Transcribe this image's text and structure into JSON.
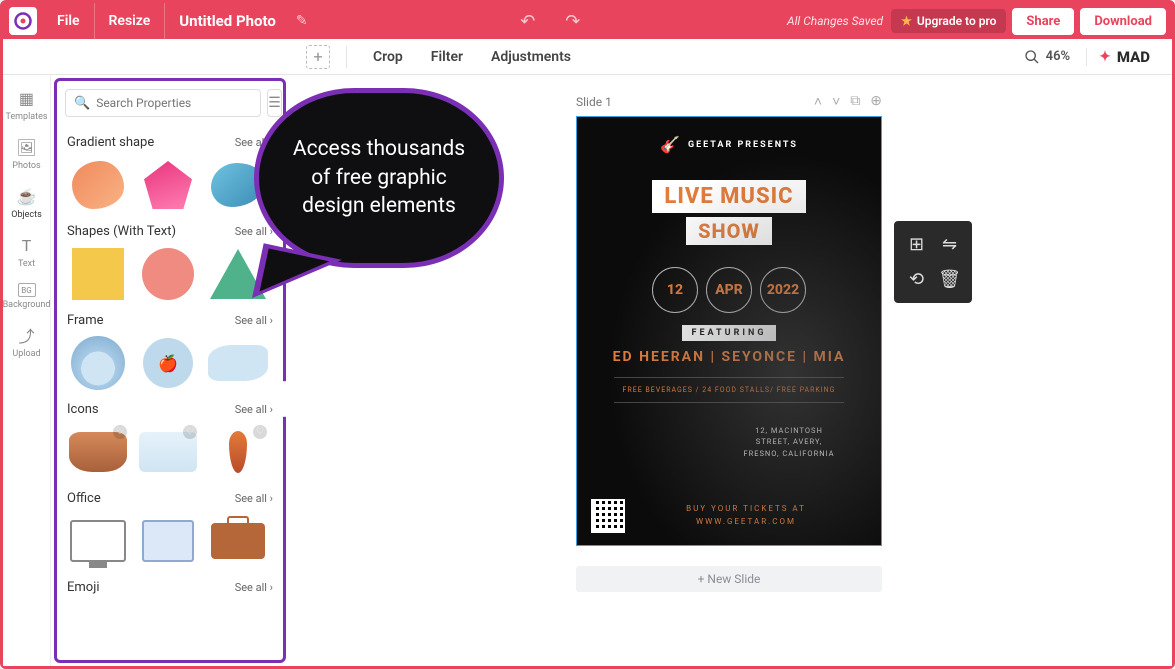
{
  "topbar": {
    "file": "File",
    "resize": "Resize",
    "title": "Untitled Photo",
    "saved": "All Changes Saved",
    "upgrade": "Upgrade to pro",
    "share": "Share",
    "download": "Download"
  },
  "toolbar": {
    "crop": "Crop",
    "filter": "Filter",
    "adjustments": "Adjustments",
    "zoom": "46%",
    "brand": "MAD"
  },
  "rail": {
    "templates": "Templates",
    "photos": "Photos",
    "objects": "Objects",
    "text": "Text",
    "background": "Background",
    "upload": "Upload"
  },
  "panel": {
    "search_placeholder": "Search Properties",
    "see_all": "See all",
    "cat_gradient": "Gradient shape",
    "cat_shapes": "Shapes (With Text)",
    "cat_frame": "Frame",
    "cat_icons": "Icons",
    "cat_office": "Office",
    "cat_emoji": "Emoji"
  },
  "bubble": "Access thousands of free graphic design elements",
  "canvas": {
    "slide_label": "Slide 1",
    "new_slide": "+ New Slide"
  },
  "poster": {
    "presenter": "GEETAR PRESENTS",
    "title1": "LIVE MUSIC",
    "title2": "SHOW",
    "day": "12",
    "month": "APR",
    "year": "2022",
    "featuring": "FEATURING",
    "artists": "ED HEERAN | SEYONCE | MIA",
    "info": "FREE BEVERAGES / 24 FOOD STALLS/ FREE PARKING",
    "addr1": "12, MACINTOSH",
    "addr2": "STREET, AVERY,",
    "addr3": "FRESNO, CALIFORNIA",
    "buy1": "BUY YOUR TICKETS AT",
    "buy2": "WWW.GEETAR.COM"
  }
}
